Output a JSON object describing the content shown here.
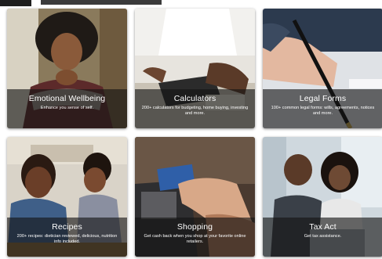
{
  "cards": [
    {
      "title": "Emotional Wellbeing",
      "desc": "Enhance you sense of self."
    },
    {
      "title": "Calculators",
      "desc": "200+ calculators for budgeting, home buying, investing and more."
    },
    {
      "title": "Legal Forms",
      "desc": "100+ common legal forms: wills, agreements, notices and more."
    },
    {
      "title": "Recipes",
      "desc": "200+ recipes: dietician reviewed, delicious, nutrition info included."
    },
    {
      "title": "Shopping",
      "desc": "Get cash back when you shop at your favorite online retailers."
    },
    {
      "title": "Tax Act",
      "desc": "Get tax assistance."
    }
  ]
}
